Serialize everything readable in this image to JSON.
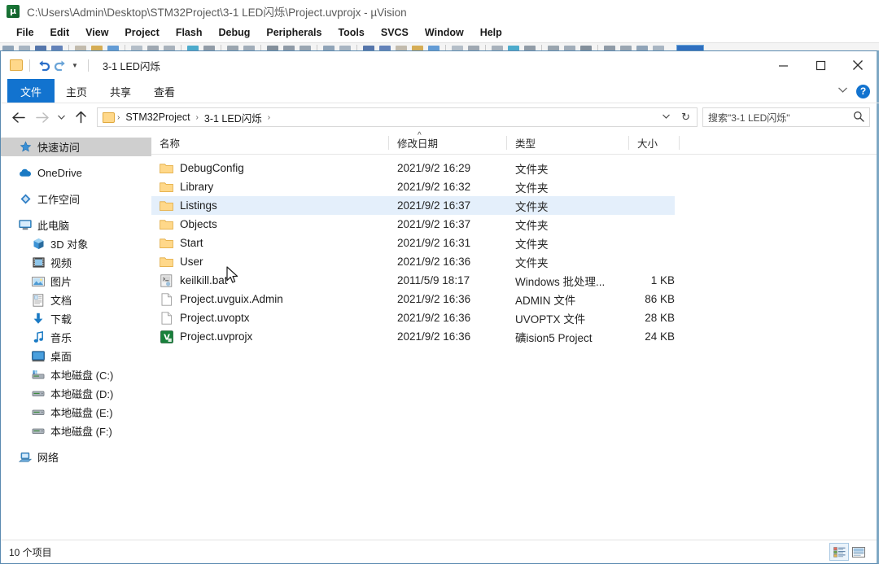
{
  "keil": {
    "title": "C:\\Users\\Admin\\Desktop\\STM32Project\\3-1 LED闪烁\\Project.uvprojx - µVision",
    "icon": "keil-uvision-icon",
    "menus": [
      "File",
      "Edit",
      "View",
      "Project",
      "Flash",
      "Debug",
      "Peripherals",
      "Tools",
      "SVCS",
      "Window",
      "Help"
    ]
  },
  "explorer": {
    "title": "3-1 LED闪烁",
    "quick_access": {
      "folder_icon": "folder-icon",
      "undo_label": "撤消",
      "redo_label": "恢复",
      "customize_label": "自定义快速访问工具栏"
    },
    "window_controls": {
      "minimize": "最小化",
      "maximize": "最大化",
      "close": "关闭"
    },
    "ribbon": {
      "file_tab": "文件",
      "tabs": [
        "主页",
        "共享",
        "查看"
      ],
      "collapse_label": "折叠功能区",
      "help_label": "?"
    },
    "address": {
      "back_label": "后退",
      "forward_label": "前进",
      "recent_label": "最近浏览的位置",
      "up_label": "上移到",
      "crumbs": [
        "STM32Project",
        "3-1 LED闪烁"
      ],
      "separator": "›",
      "dropdown": "⌄",
      "refresh": "↻"
    },
    "search": {
      "value": "搜索\"3-1 LED闪烁\"",
      "placeholder": "搜索\"3-1 LED闪烁\"",
      "icon": "search-icon"
    },
    "sidebar": {
      "items": [
        {
          "label": "快速访问",
          "icon": "star-pin-icon",
          "indent": false,
          "selected": true
        },
        {
          "label": "OneDrive",
          "icon": "cloud-icon",
          "indent": false,
          "selected": false
        },
        {
          "label": "工作空间",
          "icon": "diamond-icon",
          "indent": false,
          "selected": false
        },
        {
          "label": "此电脑",
          "icon": "computer-icon",
          "indent": false,
          "selected": false
        },
        {
          "label": "3D 对象",
          "icon": "3d-objects-icon",
          "indent": true,
          "selected": false
        },
        {
          "label": "视频",
          "icon": "video-icon",
          "indent": true,
          "selected": false
        },
        {
          "label": "图片",
          "icon": "pictures-icon",
          "indent": true,
          "selected": false
        },
        {
          "label": "文档",
          "icon": "documents-icon",
          "indent": true,
          "selected": false
        },
        {
          "label": "下载",
          "icon": "download-icon",
          "indent": true,
          "selected": false
        },
        {
          "label": "音乐",
          "icon": "music-icon",
          "indent": true,
          "selected": false
        },
        {
          "label": "桌面",
          "icon": "desktop-icon",
          "indent": true,
          "selected": false
        },
        {
          "label": "本地磁盘 (C:)",
          "icon": "system-drive-icon",
          "indent": true,
          "selected": false
        },
        {
          "label": "本地磁盘 (D:)",
          "icon": "drive-icon",
          "indent": true,
          "selected": false
        },
        {
          "label": "本地磁盘 (E:)",
          "icon": "drive-icon",
          "indent": true,
          "selected": false
        },
        {
          "label": "本地磁盘 (F:)",
          "icon": "drive-icon",
          "indent": true,
          "selected": false
        },
        {
          "label": "网络",
          "icon": "network-icon",
          "indent": false,
          "selected": false
        }
      ]
    },
    "columns": {
      "name": "名称",
      "date": "修改日期",
      "type": "类型",
      "size": "大小",
      "sort_indicator": "^"
    },
    "files": [
      {
        "name": "DebugConfig",
        "date": "2021/9/2 16:29",
        "type": "文件夹",
        "size": "",
        "icon": "folder-icon",
        "selected": false
      },
      {
        "name": "Library",
        "date": "2021/9/2 16:32",
        "type": "文件夹",
        "size": "",
        "icon": "folder-icon",
        "selected": false
      },
      {
        "name": "Listings",
        "date": "2021/9/2 16:37",
        "type": "文件夹",
        "size": "",
        "icon": "folder-icon",
        "selected": true
      },
      {
        "name": "Objects",
        "date": "2021/9/2 16:37",
        "type": "文件夹",
        "size": "",
        "icon": "folder-icon",
        "selected": false
      },
      {
        "name": "Start",
        "date": "2021/9/2 16:31",
        "type": "文件夹",
        "size": "",
        "icon": "folder-icon",
        "selected": false
      },
      {
        "name": "User",
        "date": "2021/9/2 16:36",
        "type": "文件夹",
        "size": "",
        "icon": "folder-icon",
        "selected": false
      },
      {
        "name": "keilkill.bat",
        "date": "2011/5/9 18:17",
        "type": "Windows 批处理...",
        "size": "1 KB",
        "icon": "bat-file-icon",
        "selected": false
      },
      {
        "name": "Project.uvguix.Admin",
        "date": "2021/9/2 16:36",
        "type": "ADMIN 文件",
        "size": "86 KB",
        "icon": "generic-file-icon",
        "selected": false
      },
      {
        "name": "Project.uvoptx",
        "date": "2021/9/2 16:36",
        "type": "UVOPTX 文件",
        "size": "28 KB",
        "icon": "generic-file-icon",
        "selected": false
      },
      {
        "name": "Project.uvprojx",
        "date": "2021/9/2 16:36",
        "type": "礦ision5 Project",
        "size": "24 KB",
        "icon": "keil-project-icon",
        "selected": false
      }
    ],
    "status": {
      "item_count": "10 个项目",
      "view_details": "详细信息视图",
      "view_large": "大图标视图"
    }
  },
  "colors": {
    "accent": "#1273cf",
    "selection": "#e4effb",
    "sidebar_selection": "#cfcfcf",
    "folder": "#ffd88a",
    "window_border": "#5a8ab0"
  }
}
